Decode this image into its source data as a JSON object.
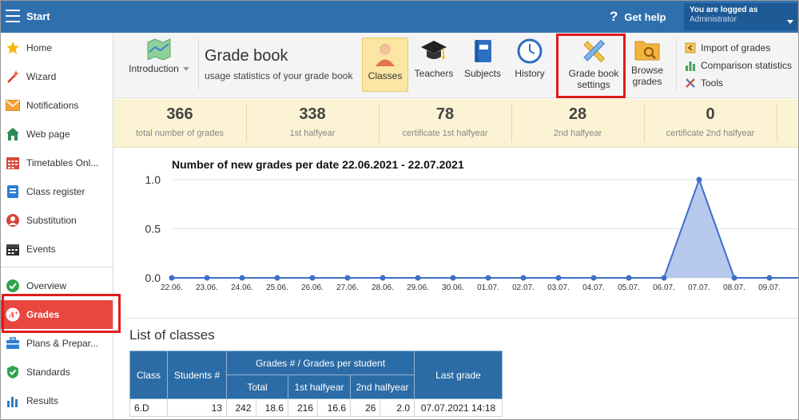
{
  "topbar": {
    "start_label": "Start",
    "help_label": "Get help",
    "user_line1": "You are logged as",
    "user_line2": "Administrator"
  },
  "sidebar": {
    "items": [
      {
        "label": "Home",
        "icon": "star-icon"
      },
      {
        "label": "Wizard",
        "icon": "magic-wand-icon"
      },
      {
        "label": "Notifications",
        "icon": "envelope-icon"
      },
      {
        "label": "Web page",
        "icon": "house-icon"
      },
      {
        "label": "Timetables Onl...",
        "icon": "calendar-grid-icon"
      },
      {
        "label": "Class register",
        "icon": "register-book-icon"
      },
      {
        "label": "Substitution",
        "icon": "person-icon"
      },
      {
        "label": "Events",
        "icon": "events-calendar-icon"
      },
      {
        "label": "Overview",
        "icon": "check-circle-icon"
      },
      {
        "label": "Grades",
        "icon": "grade-aplus-icon"
      },
      {
        "label": "Plans & Prepar...",
        "icon": "briefcase-icon"
      },
      {
        "label": "Standards",
        "icon": "shield-check-icon"
      },
      {
        "label": "Results",
        "icon": "bar-chart-icon"
      }
    ]
  },
  "toolbar": {
    "introduction_label": "Introduction",
    "title": "Grade book",
    "subtitle": "usage statistics of your grade book",
    "classes_label": "Classes",
    "teachers_label": "Teachers",
    "subjects_label": "Subjects",
    "history_label": "History",
    "settings_label_1": "Grade book",
    "settings_label_2": "settings",
    "browse_label_1": "Browse",
    "browse_label_2": "grades",
    "import_label": "Import of grades",
    "comparison_label": "Comparison statistics",
    "tools_label": "Tools"
  },
  "stats": [
    {
      "value": "366",
      "caption": "total number of grades"
    },
    {
      "value": "338",
      "caption": "1st halfyear"
    },
    {
      "value": "78",
      "caption": "certificate 1st halfyear"
    },
    {
      "value": "28",
      "caption": "2nd halfyear"
    },
    {
      "value": "0",
      "caption": "certificate 2nd halfyear"
    }
  ],
  "chart_data": {
    "type": "area",
    "title": "Number of new grades per date 22.06.2021 - 22.07.2021",
    "x": [
      "22.06.",
      "23.06.",
      "24.06.",
      "25.06.",
      "26.06.",
      "27.06.",
      "28.06.",
      "29.06.",
      "30.06.",
      "01.07.",
      "02.07.",
      "03.07.",
      "04.07.",
      "05.07.",
      "06.07.",
      "07.07.",
      "08.07.",
      "09.07."
    ],
    "values": [
      0,
      0,
      0,
      0,
      0,
      0,
      0,
      0,
      0,
      0,
      0,
      0,
      0,
      0,
      0,
      1,
      0,
      0
    ],
    "y_ticks": [
      "0.0",
      "0.5",
      "1.0"
    ],
    "ylim": [
      0,
      1
    ],
    "grid": true,
    "series_color": "#3e6fc9",
    "fill_color": "#a9c0ea"
  },
  "list": {
    "title": "List of classes",
    "headers": {
      "class": "Class",
      "students": "Students #",
      "group": "Grades # / Grades per student",
      "total": "Total",
      "first": "1st halfyear",
      "second": "2nd halfyear",
      "last": "Last grade"
    },
    "rows": [
      {
        "class": "6.D",
        "students": "13",
        "total": "242",
        "total_per": "18.6",
        "first": "216",
        "first_per": "16.6",
        "second": "26",
        "second_per": "2.0",
        "last": "07.07.2021 14:18"
      }
    ]
  },
  "colors": {
    "topbar": "#2f6fae",
    "active_item": "#e8463f",
    "highlight_border": "#e01b1b",
    "table_header": "#2c6ca6"
  }
}
